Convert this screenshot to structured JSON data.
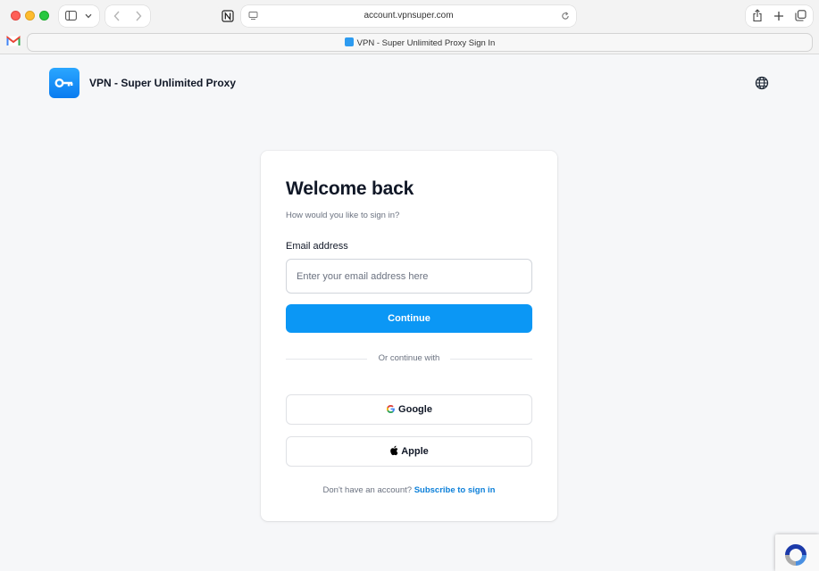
{
  "browser": {
    "url": "account.vpnsuper.com",
    "tab_title": "VPN - Super Unlimited Proxy Sign In"
  },
  "header": {
    "brand": "VPN - Super Unlimited Proxy",
    "logo_icon": "key-icon",
    "language_icon": "globe-icon"
  },
  "signin": {
    "title": "Welcome back",
    "subtitle": "How would you like to sign in?",
    "email_label": "Email address",
    "email_placeholder": "Enter your email address here",
    "email_value": "",
    "continue_label": "Continue",
    "divider_text": "Or continue with",
    "google_label": "Google",
    "apple_label": "Apple",
    "footer_text": "Don't have an account?",
    "footer_link": "Subscribe to sign in"
  },
  "colors": {
    "accent": "#0b97f5",
    "link": "#0b7fd9",
    "page_bg": "#f6f7f9"
  }
}
